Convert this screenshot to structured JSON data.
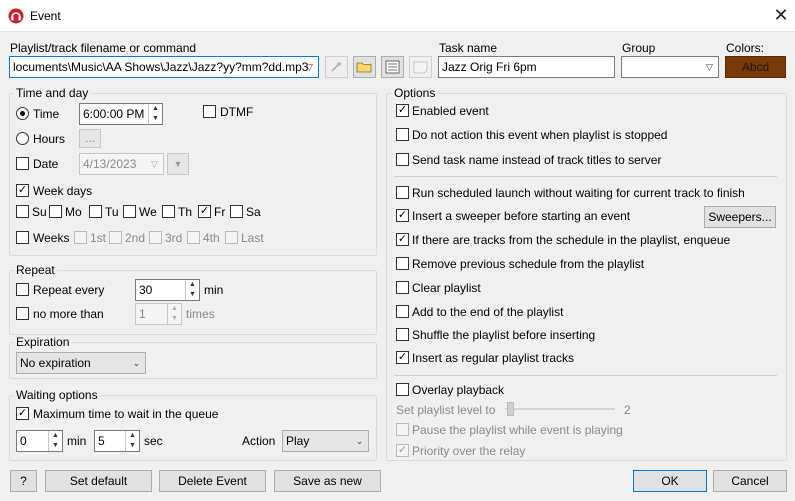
{
  "window": {
    "title": "Event",
    "close_glyph": "✕"
  },
  "top": {
    "playlist_label": "Playlist/track filename or command",
    "playlist_value": "locuments\\Music\\AA Shows\\Jazz\\Jazz?yy?mm?dd.mp3",
    "task_label": "Task name",
    "task_value": "Jazz Orig Fri 6pm",
    "group_label": "Group",
    "group_value": "",
    "colors_label": "Colors:",
    "color_sample": "Abcd",
    "color_hex": "#7a3a07",
    "toolbar_icons": [
      "wand-icon",
      "folder-icon",
      "list-icon",
      "note-icon"
    ]
  },
  "time_day": {
    "title": "Time and day",
    "time_label": "Time",
    "time_value": "6:00:00 PM",
    "dtmf_label": "DTMF",
    "hours_label": "Hours",
    "hours_btn": "...",
    "date_label": "Date",
    "date_value": "4/13/2023",
    "weekdays_label": "Week days",
    "days": [
      "Su",
      "Mo",
      "Tu",
      "We",
      "Th",
      "Fr",
      "Sa"
    ],
    "days_checked": [
      false,
      false,
      false,
      false,
      false,
      true,
      false
    ],
    "weeks_label": "Weeks",
    "weeks": [
      "1st",
      "2nd",
      "3rd",
      "4th",
      "Last"
    ]
  },
  "repeat": {
    "title": "Repeat",
    "repeat_every_label": "Repeat every",
    "repeat_value": "30",
    "repeat_unit": "min",
    "no_more_label": "no more than",
    "no_more_value": "1",
    "no_more_unit": "times"
  },
  "expiration": {
    "title": "Expiration",
    "value": "No expiration"
  },
  "waiting": {
    "title": "Waiting options",
    "max_wait_label": "Maximum time to wait in the queue",
    "min_value": "0",
    "min_unit": "min",
    "sec_value": "5",
    "sec_unit": "sec",
    "action_label": "Action",
    "action_value": "Play"
  },
  "options": {
    "title": "Options",
    "items": [
      {
        "label": "Enabled event",
        "checked": true
      },
      {
        "label": "Do not action this event when playlist is stopped",
        "checked": false
      },
      {
        "label": "Send task name instead of track titles to server",
        "checked": false
      },
      {
        "label": "Run scheduled launch without waiting for current track to finish",
        "checked": false
      },
      {
        "label": "Insert a sweeper before starting an event",
        "checked": true
      },
      {
        "label": "If there are tracks from the schedule in the playlist, enqueue",
        "checked": true
      },
      {
        "label": "Remove previous schedule from the playlist",
        "checked": false
      },
      {
        "label": "Clear playlist",
        "checked": false
      },
      {
        "label": "Add to the end of the playlist",
        "checked": false
      },
      {
        "label": "Shuffle the playlist before inserting",
        "checked": false
      },
      {
        "label": "Insert as regular playlist tracks",
        "checked": true
      },
      {
        "label": "Overlay playback",
        "checked": false
      }
    ],
    "sweepers_btn": "Sweepers...",
    "level_label": "Set playlist level to",
    "level_value": "2",
    "pause_label": "Pause the playlist while event is playing",
    "priority_label": "Priority over the relay"
  },
  "footer": {
    "help": "?",
    "set_default": "Set default",
    "delete_event": "Delete Event",
    "save_as_new": "Save as new",
    "ok": "OK",
    "cancel": "Cancel"
  }
}
